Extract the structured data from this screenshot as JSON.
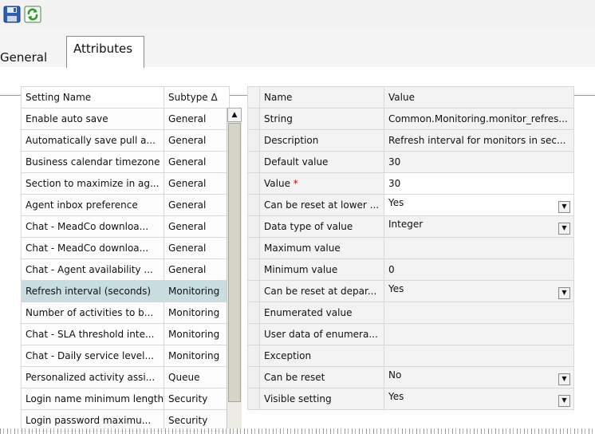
{
  "toolbar": {
    "save_icon": "save-icon",
    "refresh_icon": "refresh-icon"
  },
  "tabs": [
    {
      "label": "General",
      "active": false
    },
    {
      "label": "Attributes",
      "active": true
    }
  ],
  "settings_table": {
    "headers": [
      "Setting Name",
      "Subtype Δ"
    ],
    "rows": [
      {
        "name": "Enable auto save",
        "subtype": "General"
      },
      {
        "name": "Automatically save pull a...",
        "subtype": "General"
      },
      {
        "name": "Business calendar timezone",
        "subtype": "General"
      },
      {
        "name": "Section to maximize in ag...",
        "subtype": "General"
      },
      {
        "name": "Agent inbox preference",
        "subtype": "General"
      },
      {
        "name": "Chat - MeadCo downloa...",
        "subtype": "General"
      },
      {
        "name": "Chat - MeadCo downloa...",
        "subtype": "General"
      },
      {
        "name": "Chat - Agent availability ...",
        "subtype": "General"
      },
      {
        "name": "Refresh interval (seconds)",
        "subtype": "Monitoring",
        "selected": true
      },
      {
        "name": "Number of activities to b...",
        "subtype": "Monitoring"
      },
      {
        "name": "Chat - SLA threshold inte...",
        "subtype": "Monitoring"
      },
      {
        "name": "Chat - Daily service level...",
        "subtype": "Monitoring"
      },
      {
        "name": "Personalized activity assi...",
        "subtype": "Queue"
      },
      {
        "name": "Login name minimum length",
        "subtype": "Security"
      },
      {
        "name": "Login password maximu...",
        "subtype": "Security"
      }
    ]
  },
  "properties_table": {
    "headers": [
      "Name",
      "Value"
    ],
    "rows": [
      {
        "name": "String",
        "value": "Common.Monitoring.monitor_refres..."
      },
      {
        "name": "Description",
        "value": "Refresh interval for monitors in sec..."
      },
      {
        "name": "Default value",
        "value": "30"
      },
      {
        "name": "Value",
        "required_mark": "*",
        "value": "30",
        "editable": true
      },
      {
        "name": "Can be reset at lower ...",
        "value": "Yes",
        "dropdown": true,
        "editable": true
      },
      {
        "name": "Data type of value",
        "value": "Integer",
        "dropdown": true
      },
      {
        "name": "Maximum value",
        "value": ""
      },
      {
        "name": "Minimum value",
        "value": "0"
      },
      {
        "name": "Can be reset at depar...",
        "value": "Yes",
        "dropdown": true
      },
      {
        "name": "Enumerated value",
        "value": ""
      },
      {
        "name": "User data of enumera...",
        "value": ""
      },
      {
        "name": "Exception",
        "value": ""
      },
      {
        "name": "Can be reset",
        "value": "No",
        "dropdown": true
      },
      {
        "name": "Visible setting",
        "value": "Yes",
        "dropdown": true
      }
    ]
  },
  "colors": {
    "selected_row": "#c7dde0",
    "required": "#d00000"
  }
}
